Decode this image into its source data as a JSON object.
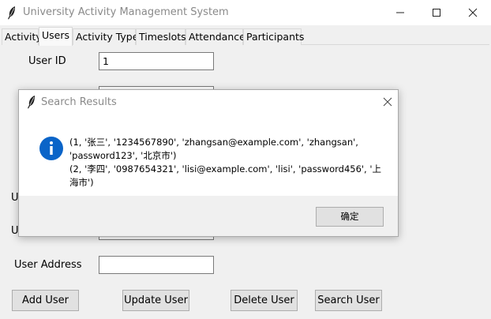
{
  "window": {
    "title": "University Activity Management System"
  },
  "tabs": [
    {
      "label": "Activity"
    },
    {
      "label": "Users"
    },
    {
      "label": "Activity Type"
    },
    {
      "label": "Timeslots"
    },
    {
      "label": "Attendance"
    },
    {
      "label": "Participants"
    }
  ],
  "active_tab": "Users",
  "form": {
    "user_id_label": "User ID",
    "user_id_value": "1",
    "row_u1_label": "U",
    "row_u2_label": "U",
    "user_address_label": "User Address",
    "user_address_value": ""
  },
  "buttons": {
    "add": "Add User",
    "update": "Update User",
    "delete": "Delete User",
    "search": "Search User"
  },
  "dialog": {
    "title": "Search Results",
    "lines": [
      "(1, '张三', '1234567890', 'zhangsan@example.com', 'zhangsan',",
      "'password123', '北京市')",
      "(2, '李四', '0987654321', 'lisi@example.com', 'lisi', 'password456', '上海市')"
    ],
    "ok_label": "确定"
  },
  "colors": {
    "info_icon": "#0a64c8",
    "titlebar_text": "#8a8a8a"
  }
}
